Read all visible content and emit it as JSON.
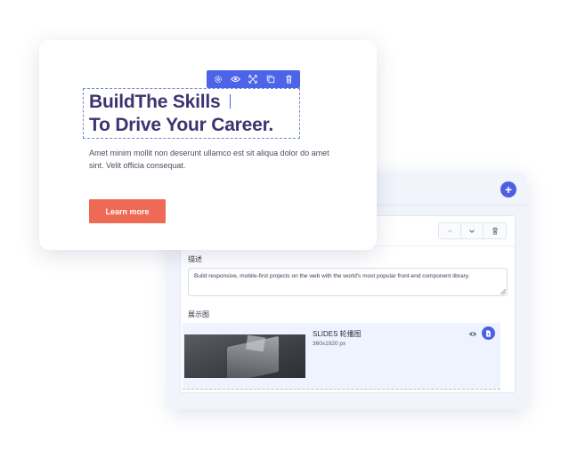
{
  "hero": {
    "headline_line1": "BuildThe Skills",
    "headline_line2": "To Drive Your Career.",
    "body": "Amet minim mollit non deserunt ullamco est sit aliqua dolor do amet sint. Velit officia consequat.",
    "cta_label": "Learn more",
    "toolbar_icons": [
      "settings-icon",
      "eye-icon",
      "move-icon",
      "copy-icon",
      "delete-icon"
    ]
  },
  "editor": {
    "add_icon": "plus-icon",
    "card_controls": [
      "chevron-up-icon",
      "chevron-down-icon",
      "trash-icon"
    ],
    "description_label": "描述",
    "description_value": "Build responsive, mobile-first projects on the web with the world's most popular front-end component library.",
    "image_label": "展示图",
    "slide_title": "SLIDES 轮播图",
    "slide_size": "360x1920 px"
  },
  "colors": {
    "accent": "#4e64e8",
    "headline": "#3d3370",
    "cta": "#ef6a55"
  }
}
